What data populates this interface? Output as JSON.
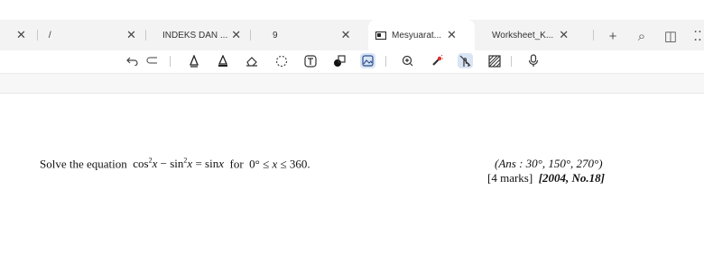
{
  "tabs": [
    {
      "label": "/",
      "close": "✕"
    },
    {
      "label": "",
      "close": "✕"
    },
    {
      "label": "INDEKS DAN ...",
      "close": "✕"
    },
    {
      "label": "9",
      "close": "✕"
    },
    {
      "label": "Mesyuarat...",
      "close": "✕",
      "active": true
    },
    {
      "label": "Worksheet_K...",
      "close": "✕"
    }
  ],
  "tab_controls": {
    "new_tab": "+",
    "search": "⌕",
    "sidebar": "◫",
    "more": "⁚⁚"
  },
  "toolbar_icons": [
    "undo-icon",
    "eraser-stroke-icon",
    "pen-icon",
    "highlighter-icon",
    "eraser-icon",
    "lasso-icon",
    "text-icon",
    "shapes-icon",
    "image-icon",
    "zoom-icon",
    "laser-pointer-icon",
    "touch-writing-icon",
    "pattern-icon",
    "microphone-icon"
  ],
  "colors": {
    "accent_selected": "#d9e4f5",
    "tabbar_bg": "#f3f3f3"
  },
  "document": {
    "q_prefix": "Solve the equation",
    "q_for": "for",
    "q_range_start": "0°",
    "q_range_end": "360.",
    "answer": "(Ans : 30°, 150°, 270°)",
    "marks_text": "[4 marks]",
    "source": "[2004, No.18]"
  }
}
